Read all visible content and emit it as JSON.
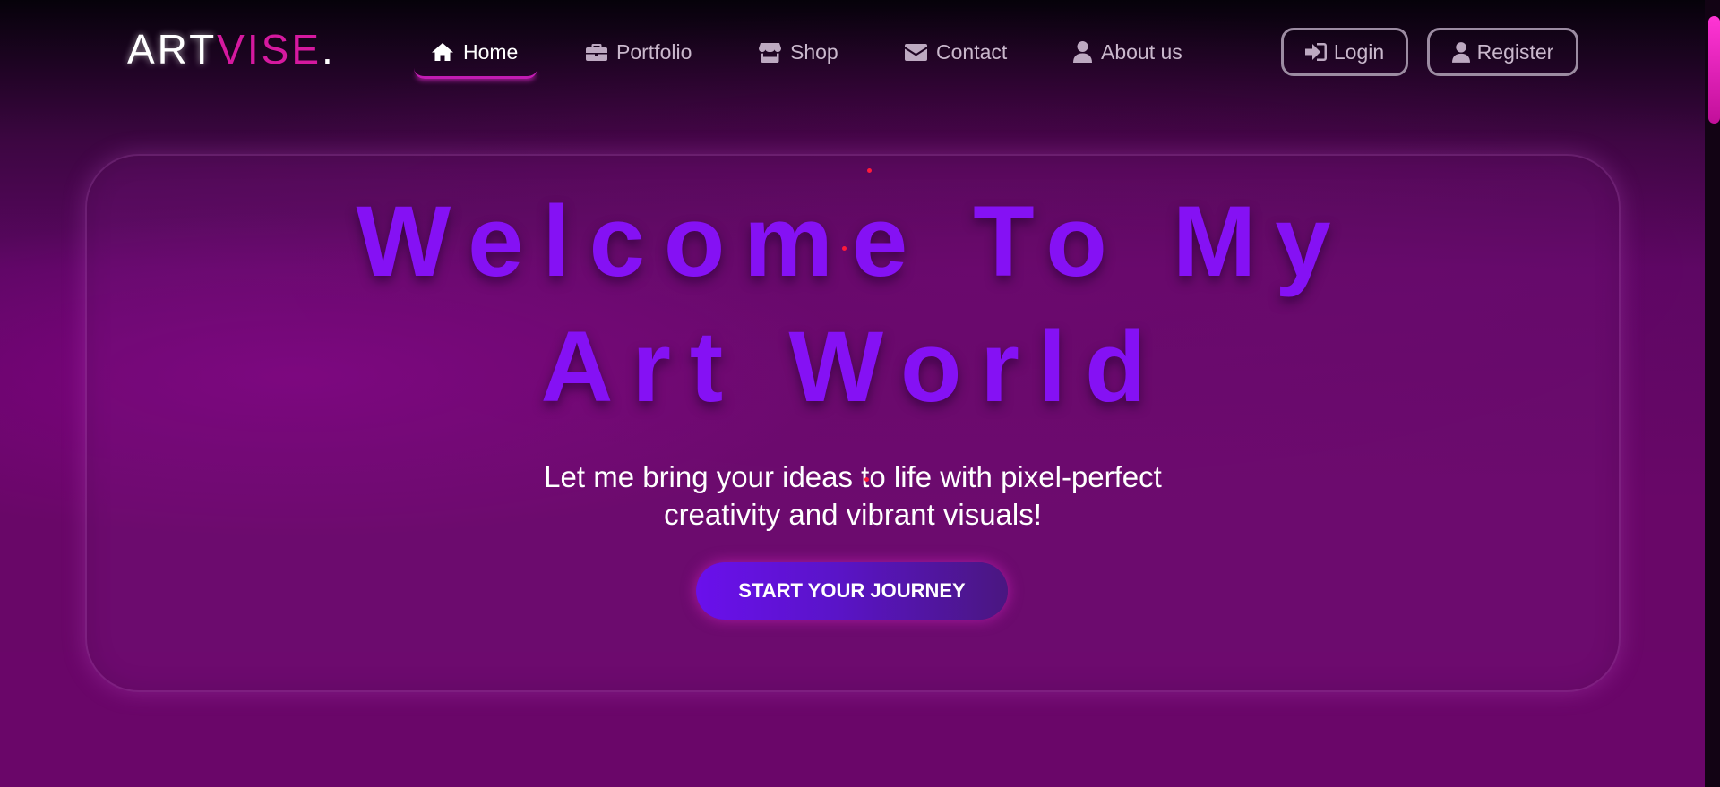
{
  "brand": {
    "part1": "ART",
    "part2": "VISE",
    "part3": ".",
    "accent_color": "#d5199f"
  },
  "nav": {
    "items": [
      {
        "label": "Home",
        "icon": "home-icon",
        "active": true
      },
      {
        "label": "Portfolio",
        "icon": "briefcase-icon",
        "active": false
      },
      {
        "label": "Shop",
        "icon": "store-icon",
        "active": false
      },
      {
        "label": "Contact",
        "icon": "envelope-icon",
        "active": false
      },
      {
        "label": "About us",
        "icon": "user-icon",
        "active": false
      }
    ],
    "active_underline_color": "#c21cb2"
  },
  "auth": {
    "login_label": "Login",
    "login_icon": "sign-in-icon",
    "register_label": "Register",
    "register_icon": "user-icon"
  },
  "hero": {
    "title_line1": "Welcome To My",
    "title_line2": "Art World",
    "title_color": "#8511f4",
    "subtitle_line1": "Let me bring your ideas to life with pixel-perfect",
    "subtitle_line2": "creativity and vibrant visuals!",
    "cta_label": "START YOUR JOURNEY"
  },
  "colors": {
    "background": "#690768",
    "button_gradient_start": "#6a10ec",
    "scroll_thumb": "#ff35d5"
  }
}
